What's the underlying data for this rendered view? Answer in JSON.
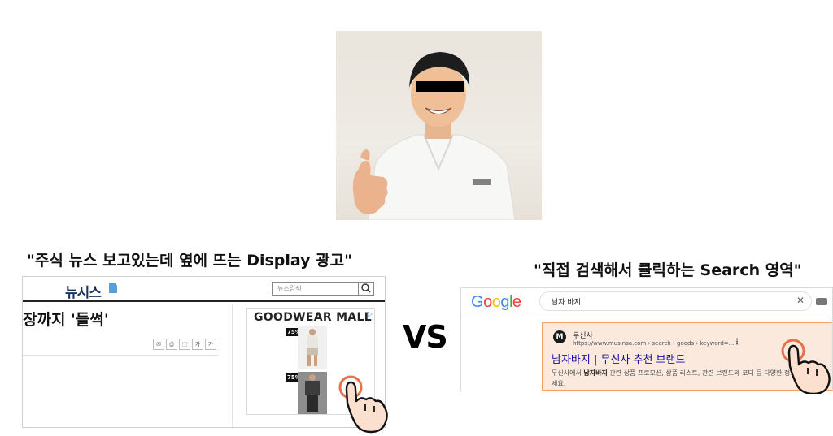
{
  "captions": {
    "left": "\"주식 뉴스 보고있는데 옆에 뜨는 Display 광고\"",
    "vs": "VS",
    "right": "\"직접 검색해서 클릭하는 Search 영역\""
  },
  "news": {
    "logo": "뉴시스",
    "search_placeholder": "뉴스검색",
    "headline": "장까지 '들썩'",
    "tools": [
      "✉",
      "⎙",
      "⬚",
      "가",
      "가"
    ]
  },
  "ad": {
    "brand": "GOODWEAR MALL",
    "info_icon": "ad-choices-icon",
    "items": [
      {
        "discount": "75%"
      },
      {
        "discount": "75%"
      }
    ]
  },
  "google": {
    "logo": "Google",
    "query": "남자 바지",
    "clear": "✕",
    "result": {
      "favicon_letter": "M",
      "site_name": "무신사",
      "url": "https://www.musinsa.com › search › goods › keyword=...",
      "more": "⋮",
      "title": "남자바지 | 무신사 추천 브랜드",
      "snippet_pre": "무신사에서 ",
      "snippet_bold": "남자바지",
      "snippet_post": " 관련 상품 프로모션, 상품 리스트, 관련 브랜드와 코디 등 다양한 정보를 확인해보세요."
    }
  },
  "colors": {
    "result_highlight": "#fbe9dd",
    "result_border": "#f2a36c",
    "google_link": "#1a0dab",
    "tap_ring": "#e8714a"
  }
}
